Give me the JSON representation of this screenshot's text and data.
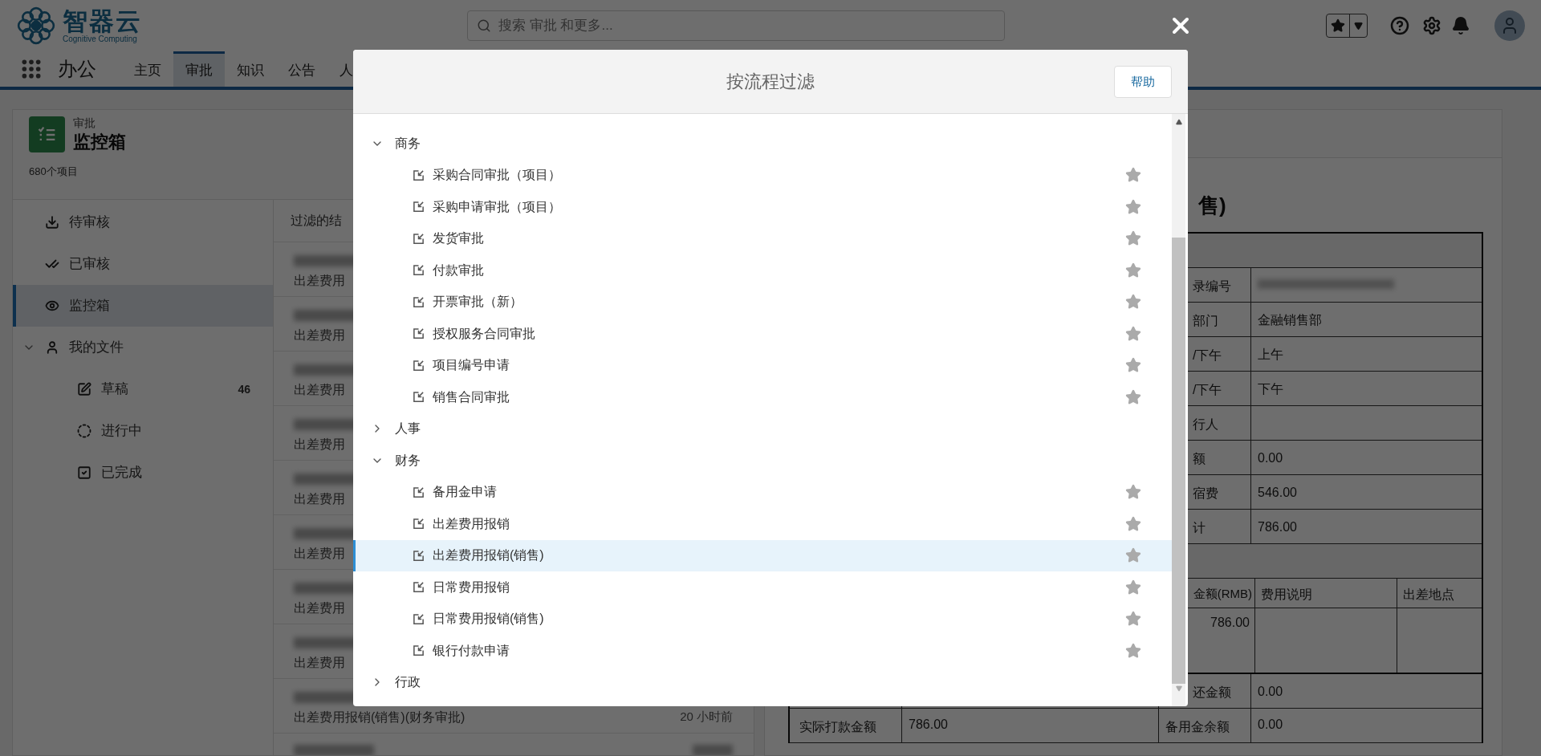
{
  "header": {
    "logo": {
      "name": "智器云",
      "tagline": "Cognitive Computing"
    },
    "search": {
      "placeholder": "搜索 审批 和更多..."
    }
  },
  "nav": {
    "app_title": "办公",
    "tabs": [
      {
        "label": "主页",
        "selected": false
      },
      {
        "label": "审批",
        "selected": true
      },
      {
        "label": "知识",
        "selected": false
      },
      {
        "label": "公告",
        "selected": false
      },
      {
        "label": "人",
        "selected": false
      }
    ]
  },
  "page_header": {
    "category": "审批",
    "title": "监控箱",
    "count": "680个项目"
  },
  "sidebar": {
    "items": [
      {
        "label": "待审核",
        "selected": false
      },
      {
        "label": "已审核",
        "selected": false
      },
      {
        "label": "监控箱",
        "selected": true
      },
      {
        "label": "我的文件",
        "selected": false,
        "expanded": true,
        "children": [
          {
            "label": "草稿",
            "selected": false,
            "badge": "46"
          },
          {
            "label": "进行中",
            "selected": false
          },
          {
            "label": "已完成",
            "selected": false
          }
        ]
      }
    ]
  },
  "list": {
    "header": "过滤的结",
    "rows": [
      {
        "kind": "item",
        "subtitle": "出差费用"
      },
      {
        "kind": "item",
        "subtitle": "出差费用"
      },
      {
        "kind": "item",
        "subtitle": "出差费用"
      },
      {
        "kind": "item",
        "subtitle": "出差费用"
      },
      {
        "kind": "item",
        "subtitle": "出差费用"
      },
      {
        "kind": "item",
        "subtitle": "出差费用"
      },
      {
        "kind": "item",
        "subtitle": "出差费用"
      },
      {
        "kind": "item",
        "subtitle": "出差费用"
      },
      {
        "kind": "item",
        "subtitle": "出差费用报销(销售)(财务审批)",
        "time": "20 小时前"
      },
      {
        "kind": "blurred"
      }
    ]
  },
  "detail": {
    "title": "售)",
    "rows": [
      {
        "kind": "band"
      },
      {
        "kind": "field",
        "label": "录编号",
        "blurred": true
      },
      {
        "kind": "field",
        "label": "部门",
        "value": "金融销售部"
      },
      {
        "kind": "field",
        "label": "/下午",
        "value": "上午"
      },
      {
        "kind": "field",
        "label": "/下午",
        "value": "下午"
      },
      {
        "kind": "field",
        "label": "行人"
      },
      {
        "kind": "field",
        "label": "额",
        "value": "0.00"
      },
      {
        "kind": "field",
        "label": "宿费",
        "value": "546.00"
      },
      {
        "kind": "field",
        "label": "计",
        "value": "786.00"
      },
      {
        "kind": "band"
      },
      {
        "kind": "sub_header",
        "cells": [
          "金额(RMB)",
          "费用说明",
          "出差地点"
        ]
      },
      {
        "kind": "sub_row",
        "amount": "786.00"
      },
      {
        "kind": "field",
        "label": "还金额",
        "value": "0.00"
      },
      {
        "kind": "pair",
        "label": "实际打款金额",
        "value": "786.00",
        "label2": "备用金余额",
        "value2": "0.00"
      }
    ]
  },
  "modal": {
    "title": "按流程过滤",
    "help_button": "帮助",
    "groups": [
      {
        "label": "商务",
        "expanded": true,
        "children": [
          {
            "label": "采购合同审批（项目）",
            "selected": false,
            "starred": false
          },
          {
            "label": "采购申请审批（项目）",
            "selected": false,
            "starred": false
          },
          {
            "label": "发货审批",
            "selected": false,
            "starred": false
          },
          {
            "label": "付款审批",
            "selected": false,
            "starred": false
          },
          {
            "label": "开票审批（新）",
            "selected": false,
            "starred": false
          },
          {
            "label": "授权服务合同审批",
            "selected": false,
            "starred": false
          },
          {
            "label": "项目编号申请",
            "selected": false,
            "starred": false
          },
          {
            "label": "销售合同审批",
            "selected": false,
            "starred": false
          }
        ]
      },
      {
        "label": "人事",
        "expanded": false
      },
      {
        "label": "财务",
        "expanded": true,
        "children": [
          {
            "label": "备用金申请",
            "selected": false,
            "starred": false
          },
          {
            "label": "出差费用报销",
            "selected": false,
            "starred": false
          },
          {
            "label": "出差费用报销(销售)",
            "selected": true,
            "starred": false
          },
          {
            "label": "日常费用报销",
            "selected": false,
            "starred": false
          },
          {
            "label": "日常费用报销(销售)",
            "selected": false,
            "starred": false
          },
          {
            "label": "银行付款申请",
            "selected": false,
            "starred": false
          }
        ]
      },
      {
        "label": "行政",
        "expanded": false
      }
    ]
  }
}
